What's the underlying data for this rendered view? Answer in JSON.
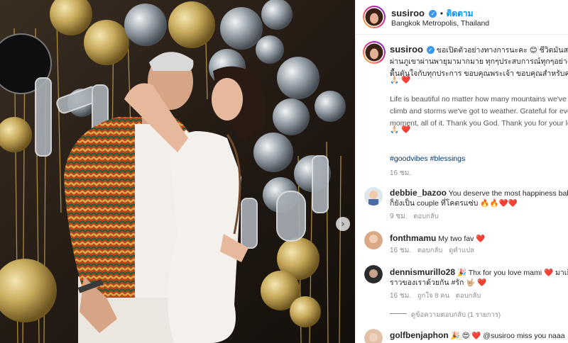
{
  "post": {
    "author": "susiroo",
    "dot": "•",
    "follow_label": "ติดตาม",
    "location": "Bangkok Metropolis, Thailand",
    "next_arrow": "›"
  },
  "caption": {
    "author": "susiroo",
    "line1": "ขอเปิดตัวอย่างทางการนะคะ 😊 ชีวิตมันสวยงา",
    "line2": "ผ่านภูเขาผ่านพายุมามากมาย ทุกๆประสบการณ์ทุกๆอย่างขึ้",
    "line3": "ดื้นตันใจกับทุกประการ ขอบคุณพระเจ้า ขอบคุณสำหรับความ",
    "emojis1": "🙏🏻 ❤️",
    "en1": "Life is beautiful no matter how many mountains we've g",
    "en2": "climb and storms we've got to weather. Grateful for eve",
    "en3": "moment, all of it. Thank you God. Thank you for your lo",
    "emojis2": "🙏🏻 ❤️",
    "hashtags": "#goodvibes #blessings",
    "time": "16 ชม."
  },
  "comments": [
    {
      "user": "debbie_bazoo",
      "text": "You deserve the most happiness baby!",
      "text2": "ก็ยังเป็น couple ที่โคตรแซ่บ 🔥🔥❤️❤️",
      "time": "9 ชม.",
      "reply": "ตอบกลับ"
    },
    {
      "user": "fonthmamu",
      "text": "My two fav ❤️",
      "time": "16 ชม.",
      "reply": "ตอบกลับ",
      "translate": "ดูคำแปล"
    },
    {
      "user": "dennismurillo28",
      "text": "🎉 Thx for you love mami ❤️ มาเยี่ย",
      "text2": "ราวของเราด้วยกัน #รัก 🤟🏼 ❤️",
      "time": "16 ชม.",
      "likes": "ถูกใจ 8 คน",
      "reply": "ตอบกลับ",
      "view_replies": "ดูข้อความตอบกลับ (1 รายการ)"
    },
    {
      "user": "golfbenjaphon",
      "text": "🎉 😍 ❤️ @susiroo miss you naaa"
    }
  ],
  "colors": {
    "accent": "#0095f6",
    "verified": "#3897f0",
    "heart": "#ed4956"
  }
}
